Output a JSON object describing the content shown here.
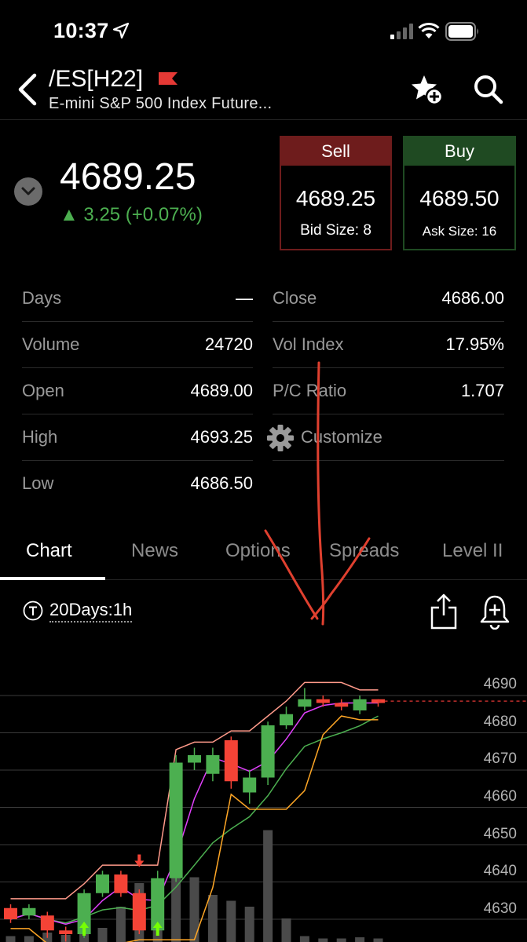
{
  "status_bar": {
    "time": "10:37"
  },
  "header": {
    "symbol": "/ES[H22]",
    "subtitle": "E-mini S&P 500 Index Future..."
  },
  "quote": {
    "last": "4689.25",
    "change": "▲ 3.25 (+0.07%)",
    "sell": {
      "label": "Sell",
      "price": "4689.25",
      "size": "Bid Size: 8"
    },
    "buy": {
      "label": "Buy",
      "price": "4689.50",
      "size": "Ask Size: 16"
    }
  },
  "stats_left": [
    {
      "label": "Days",
      "value": "—"
    },
    {
      "label": "Volume",
      "value": "24720"
    },
    {
      "label": "Open",
      "value": "4689.00"
    },
    {
      "label": "High",
      "value": "4693.25"
    },
    {
      "label": "Low",
      "value": "4686.50"
    }
  ],
  "stats_right": [
    {
      "label": "Close",
      "value": "4686.00"
    },
    {
      "label": "Vol Index",
      "value": "17.95%"
    },
    {
      "label": "P/C Ratio",
      "value": "1.707"
    }
  ],
  "customize_label": "Customize",
  "tabs": [
    "Chart",
    "News",
    "Options",
    "Spreads",
    "Level II"
  ],
  "chart_toolbar": {
    "period": "20Days:1h"
  },
  "colors": {
    "up": "#4caf50",
    "down": "#f44336",
    "sell": "#6e1c1c",
    "buy": "#1f4a22",
    "annotation": "#e0402f"
  },
  "chart_data": {
    "type": "candlestick",
    "y_ticks": [
      4690,
      4680,
      4670,
      4660,
      4650,
      4640,
      4630
    ],
    "last_price_line": 4688.5,
    "candles": [
      {
        "o": 4633,
        "c": 4630,
        "h": 4634,
        "l": 4629
      },
      {
        "o": 4631,
        "c": 4633,
        "h": 4634,
        "l": 4630
      },
      {
        "o": 4631,
        "c": 4627,
        "h": 4632,
        "l": 4625
      },
      {
        "o": 4627,
        "c": 4626,
        "h": 4628,
        "l": 4624
      },
      {
        "o": 4626,
        "c": 4637,
        "h": 4638,
        "l": 4625
      },
      {
        "o": 4637,
        "c": 4642,
        "h": 4643,
        "l": 4636
      },
      {
        "o": 4642,
        "c": 4637,
        "h": 4643,
        "l": 4636
      },
      {
        "o": 4637,
        "c": 4627,
        "h": 4638,
        "l": 4626
      },
      {
        "o": 4627,
        "c": 4641,
        "h": 4643,
        "l": 4626
      },
      {
        "o": 4641,
        "c": 4672,
        "h": 4674,
        "l": 4640
      },
      {
        "o": 4672,
        "c": 4674,
        "h": 4676,
        "l": 4670
      },
      {
        "o": 4669,
        "c": 4674,
        "h": 4676,
        "l": 4667
      },
      {
        "o": 4678,
        "c": 4667,
        "h": 4679,
        "l": 4665
      },
      {
        "o": 4664,
        "c": 4668,
        "h": 4670,
        "l": 4661
      },
      {
        "o": 4668,
        "c": 4682,
        "h": 4683,
        "l": 4666
      },
      {
        "o": 4682,
        "c": 4685,
        "h": 4687,
        "l": 4681
      },
      {
        "o": 4687,
        "c": 4689,
        "h": 4692,
        "l": 4686
      },
      {
        "o": 4689,
        "c": 4688,
        "h": 4690,
        "l": 4687
      },
      {
        "o": 4688,
        "c": 4687,
        "h": 4689,
        "l": 4686
      },
      {
        "o": 4686,
        "c": 4689,
        "h": 4690,
        "l": 4685
      },
      {
        "o": 4689,
        "c": 4688,
        "h": 4689,
        "l": 4687
      }
    ],
    "volume_rel": [
      0.05,
      0.05,
      0.08,
      0.06,
      0.1,
      0.12,
      0.3,
      0.5,
      0.45,
      0.6,
      0.55,
      0.4,
      0.35,
      0.3,
      0.95,
      0.2,
      0.05,
      0.03,
      0.03,
      0.04,
      0.03
    ]
  }
}
